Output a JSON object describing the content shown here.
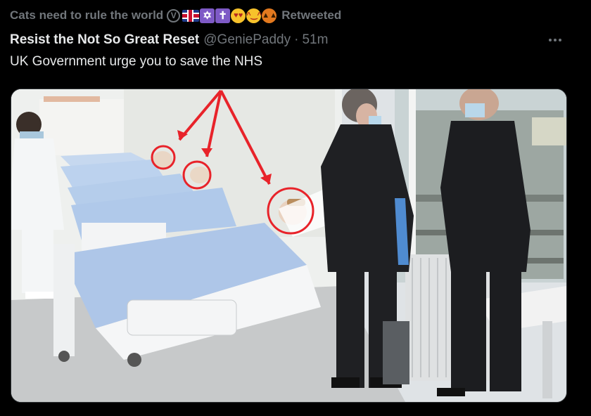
{
  "retweet": {
    "user_name": "Cats need to rule the world",
    "emojis": [
      "vegan-v-icon",
      "uk-flag-icon",
      "star-of-david-icon",
      "latin-cross-icon",
      "heart-eyes-face-icon",
      "kissing-cat-icon",
      "jack-o-lantern-icon"
    ],
    "label": "Retweeted"
  },
  "tweet": {
    "author_name": "Resist the Not So Great Reset",
    "author_handle": "@GeniePaddy",
    "separator": "·",
    "time": "51m",
    "text": "UK Government urge you to save the NHS"
  },
  "media": {
    "description_icon": "photo-hospital-ward-mannequins",
    "annotation_color": "#e8232a"
  }
}
